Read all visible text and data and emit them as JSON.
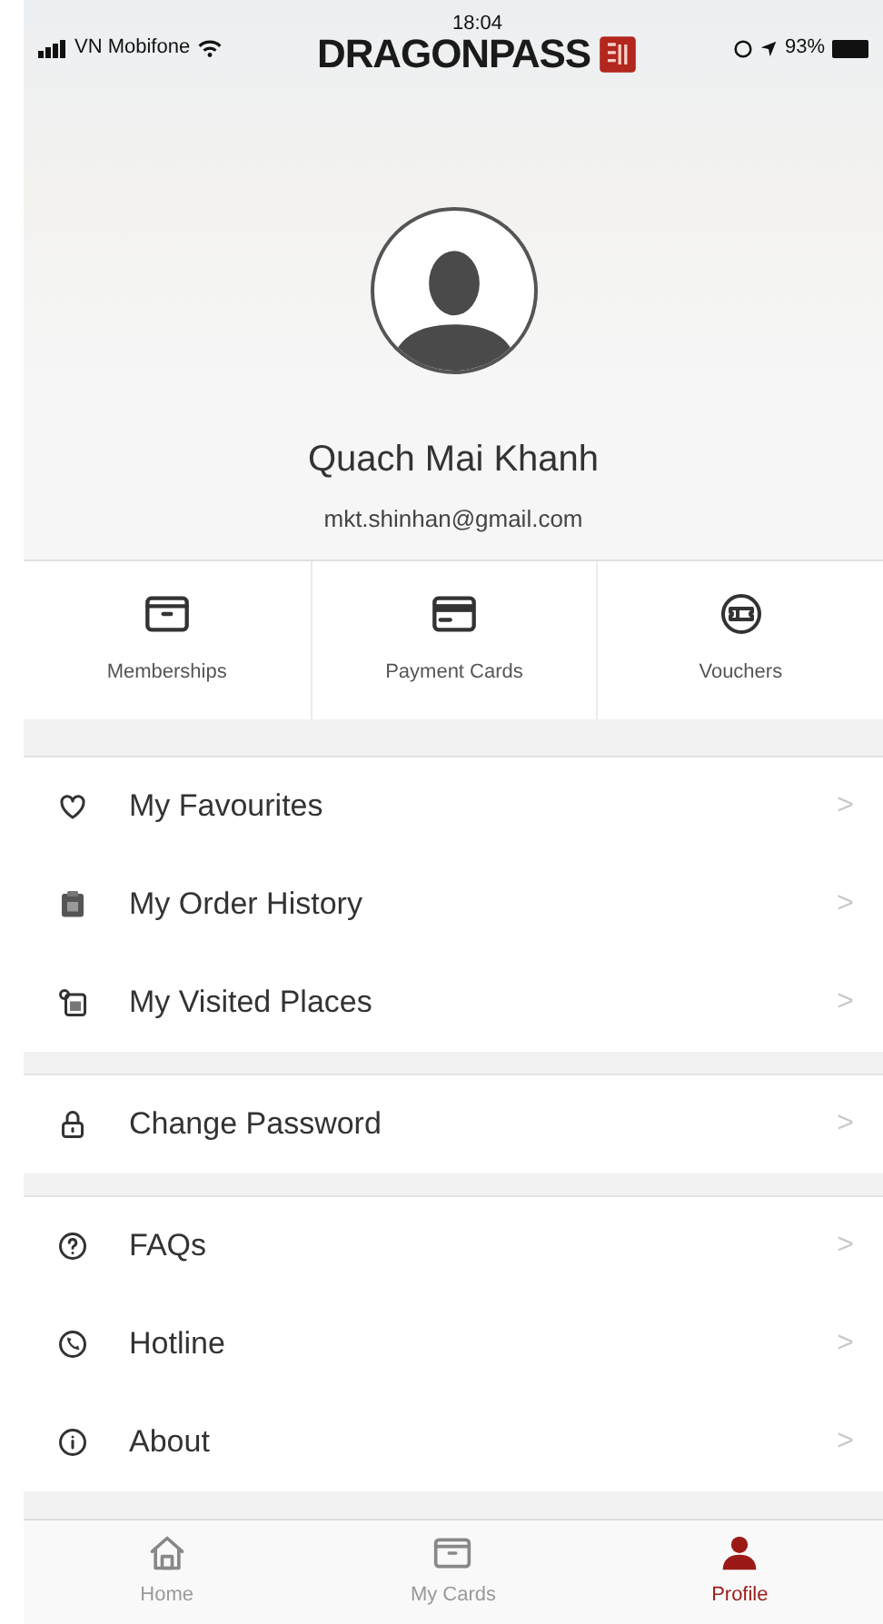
{
  "status_bar": {
    "carrier": "VN Mobifone",
    "time": "18:04",
    "battery": "93%"
  },
  "header": {
    "logo": "DRAGONPASS"
  },
  "profile": {
    "name": "Quach Mai Khanh",
    "email": "mkt.shinhan@gmail.com"
  },
  "shortcuts": [
    {
      "kind": "membership",
      "label": "Memberships"
    },
    {
      "kind": "card",
      "label": "Payment Cards"
    },
    {
      "kind": "voucher",
      "label": "Vouchers"
    }
  ],
  "menu_groups": [
    [
      {
        "kind": "heart",
        "label": "My Favourites",
        "chevron": ">"
      },
      {
        "kind": "order",
        "label": "My Order History",
        "chevron": ">"
      },
      {
        "kind": "visited",
        "label": "My Visited Places",
        "chevron": ">"
      }
    ],
    [
      {
        "kind": "lock",
        "label": "Change Password",
        "chevron": ">"
      }
    ],
    [
      {
        "kind": "faq",
        "label": "FAQs",
        "chevron": ">"
      },
      {
        "kind": "phone",
        "label": "Hotline",
        "chevron": ">"
      },
      {
        "kind": "info",
        "label": "About",
        "chevron": ">"
      }
    ]
  ],
  "tab_bar": [
    {
      "kind": "home",
      "label": "Home",
      "selected": false
    },
    {
      "kind": "cards",
      "label": "My Cards",
      "selected": false
    },
    {
      "kind": "profile",
      "label": "Profile",
      "selected": true
    }
  ]
}
